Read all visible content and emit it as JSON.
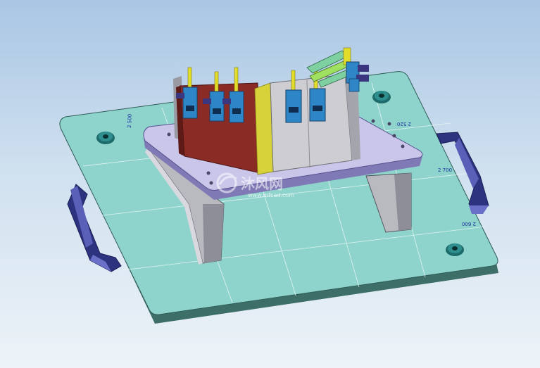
{
  "scene": {
    "kind": "cad-3d-render",
    "subject": "welding fixture on base plate",
    "background_top": "#a9c6e4",
    "background_bottom": "#edf3f8",
    "baseplate_color": "#8fd4cc",
    "handle_color": "#3a3f8f",
    "platform_color": "#c9c6ea",
    "part_color": "#8b2b25",
    "clamp_color": "#2f86c6",
    "pin_color": "#e2dc2a"
  },
  "dimensions": {
    "left": "2 500",
    "right_upper": "2 520",
    "right_middle": "2 700",
    "right_lower": "2 600"
  },
  "watermark": {
    "text": "沐风网",
    "url": "www.mfcad.com"
  }
}
